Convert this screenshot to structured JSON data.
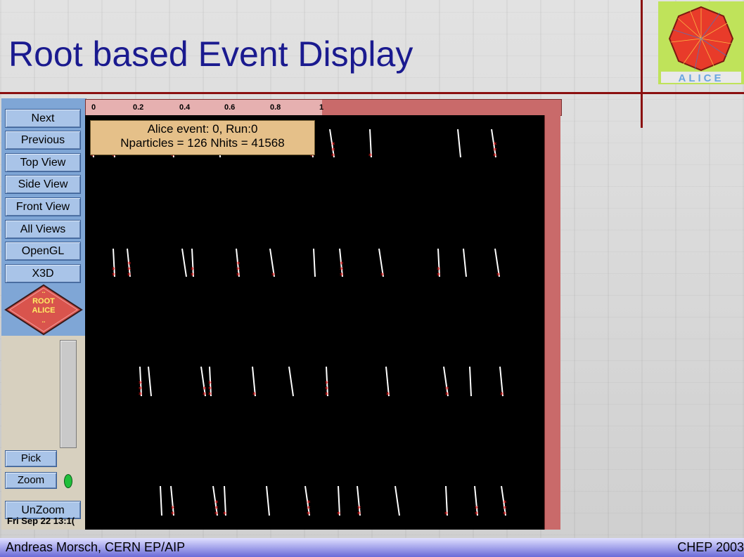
{
  "slide": {
    "title": "Root based Event Display",
    "footer_left": "Andreas Morsch, CERN EP/AIP",
    "footer_right": "CHEP 2003",
    "logo_text": "ALICE"
  },
  "colors": {
    "title": "#1a1a8f",
    "rule": "#8b1010",
    "panel_top": "#7fa6d6",
    "button": "#a9c4e8",
    "canvas": "#000000",
    "hit_marker": "#ff2020",
    "track": "#ffffff",
    "info_box": "#e5c089"
  },
  "controls": {
    "buttons": [
      "Next",
      "Previous",
      "Top View",
      "Side View",
      "Front View",
      "All Views",
      "OpenGL",
      "X3D"
    ],
    "root_logo_lines": [
      "..",
      "ROOT",
      "ALICE",
      ".."
    ],
    "pick_label": "Pick",
    "zoom_label": "Zoom",
    "unzoom_label": "UnZoom",
    "datestamp": "Fri Sep 22 13:1("
  },
  "display": {
    "ruler_ticks": [
      "0",
      "0.2",
      "0.4",
      "0.6",
      "0.8",
      "1"
    ],
    "info_line1": "Alice event: 0, Run:0",
    "info_line2": "Nparticles = 126   Nhits = 41568"
  }
}
